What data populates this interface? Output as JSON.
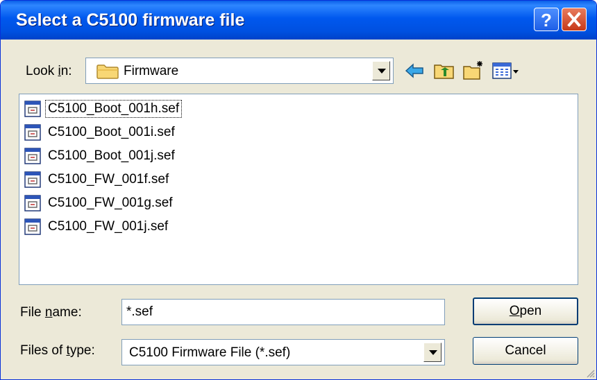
{
  "window": {
    "title": "Select a C5100 firmware file"
  },
  "lookin": {
    "label_pre": "Look ",
    "label_key": "i",
    "label_post": "n:",
    "value": "Firmware"
  },
  "files": [
    {
      "name": "C5100_Boot_001h.sef"
    },
    {
      "name": "C5100_Boot_001i.sef"
    },
    {
      "name": "C5100_Boot_001j.sef"
    },
    {
      "name": "C5100_FW_001f.sef"
    },
    {
      "name": "C5100_FW_001g.sef"
    },
    {
      "name": "C5100_FW_001j.sef"
    }
  ],
  "filename": {
    "label_pre": "File ",
    "label_key": "n",
    "label_post": "ame:",
    "value": "*.sef"
  },
  "filetype": {
    "label_pre": "Files of ",
    "label_key": "t",
    "label_post": "ype:",
    "value": "C5100 Firmware File (*.sef)"
  },
  "buttons": {
    "open_key": "O",
    "open_rest": "pen",
    "cancel": "Cancel"
  },
  "icons": {
    "help": "question-mark-icon",
    "close": "close-icon",
    "folder": "folder-icon",
    "back": "back-arrow-icon",
    "up": "up-folder-icon",
    "new_folder": "new-folder-icon",
    "view_menu": "view-menu-icon",
    "file": "sef-file-icon"
  },
  "colors": {
    "titlebar": "#0058ee",
    "window_bg": "#ece9d8",
    "close": "#c6391a"
  }
}
